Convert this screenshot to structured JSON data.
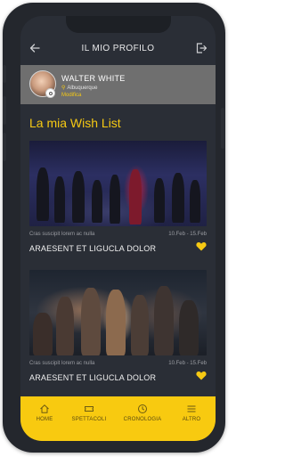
{
  "header": {
    "title": "IL MIO PROFILO",
    "back_icon": "arrow-left-icon",
    "logout_icon": "logout-icon"
  },
  "profile": {
    "name": "WALTER WHITE",
    "location": "Albuquerque",
    "edit_label": "Modifica"
  },
  "wishlist": {
    "title": "La mia Wish List",
    "items": [
      {
        "subtitle": "Cras suscipit lorem ac nulla",
        "dates": "10.Feb - 15.Feb",
        "title": "ARAESENT ET LIGUCLA DOLOR",
        "favorite": true
      },
      {
        "subtitle": "Cras suscipit lorem ac nulla",
        "dates": "10.Feb - 15.Feb",
        "title": "ARAESENT ET LIGUCLA DOLOR",
        "favorite": true
      }
    ]
  },
  "tabbar": {
    "items": [
      {
        "label": "HOME",
        "icon": "home-icon"
      },
      {
        "label": "SPETTACOLI",
        "icon": "ticket-icon"
      },
      {
        "label": "CRONOLOGIA",
        "icon": "clock-icon"
      },
      {
        "label": "ALTRO",
        "icon": "menu-icon"
      }
    ]
  },
  "colors": {
    "accent": "#f6c913",
    "screen_bg": "#2a2e36",
    "profile_bg": "#6f6f6f",
    "tabbar_bg": "#f8ca10"
  }
}
